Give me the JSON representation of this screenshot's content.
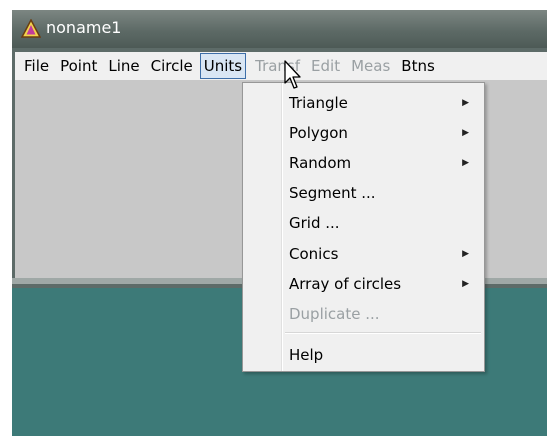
{
  "window": {
    "title": "noname1"
  },
  "menubar": {
    "items": [
      {
        "label": "File",
        "enabled": true
      },
      {
        "label": "Point",
        "enabled": true
      },
      {
        "label": "Line",
        "enabled": true
      },
      {
        "label": "Circle",
        "enabled": true
      },
      {
        "label": "Units",
        "enabled": true,
        "open": true
      },
      {
        "label": "Transf",
        "enabled": false
      },
      {
        "label": "Edit",
        "enabled": false
      },
      {
        "label": "Meas",
        "enabled": false
      },
      {
        "label": "Btns",
        "enabled": true
      }
    ]
  },
  "units_menu": {
    "items": [
      {
        "label": "Triangle",
        "submenu": true,
        "enabled": true
      },
      {
        "label": "Polygon",
        "submenu": true,
        "enabled": true
      },
      {
        "label": "Random",
        "submenu": true,
        "enabled": true
      },
      {
        "label": "Segment ...",
        "submenu": false,
        "enabled": true
      },
      {
        "label": "Grid ...",
        "submenu": false,
        "enabled": true
      },
      {
        "label": "Conics",
        "submenu": true,
        "enabled": true
      },
      {
        "label": "Array of circles",
        "submenu": true,
        "enabled": true
      },
      {
        "label": "Duplicate ...",
        "submenu": false,
        "enabled": false
      },
      {
        "label": "Help",
        "submenu": false,
        "enabled": true
      }
    ]
  },
  "icons": {
    "app": "warning-triangle-icon",
    "submenu_arrow": "chevron-right-icon",
    "cursor": "mouse-pointer-icon"
  },
  "colors": {
    "titlebar": "#5d6a66",
    "menubar": "#f0f0f0",
    "client": "#c8c8c8",
    "desktop": "#3d7a78",
    "disabled_text": "#9aa0a3",
    "active_menu_border": "#3d6ea8"
  }
}
